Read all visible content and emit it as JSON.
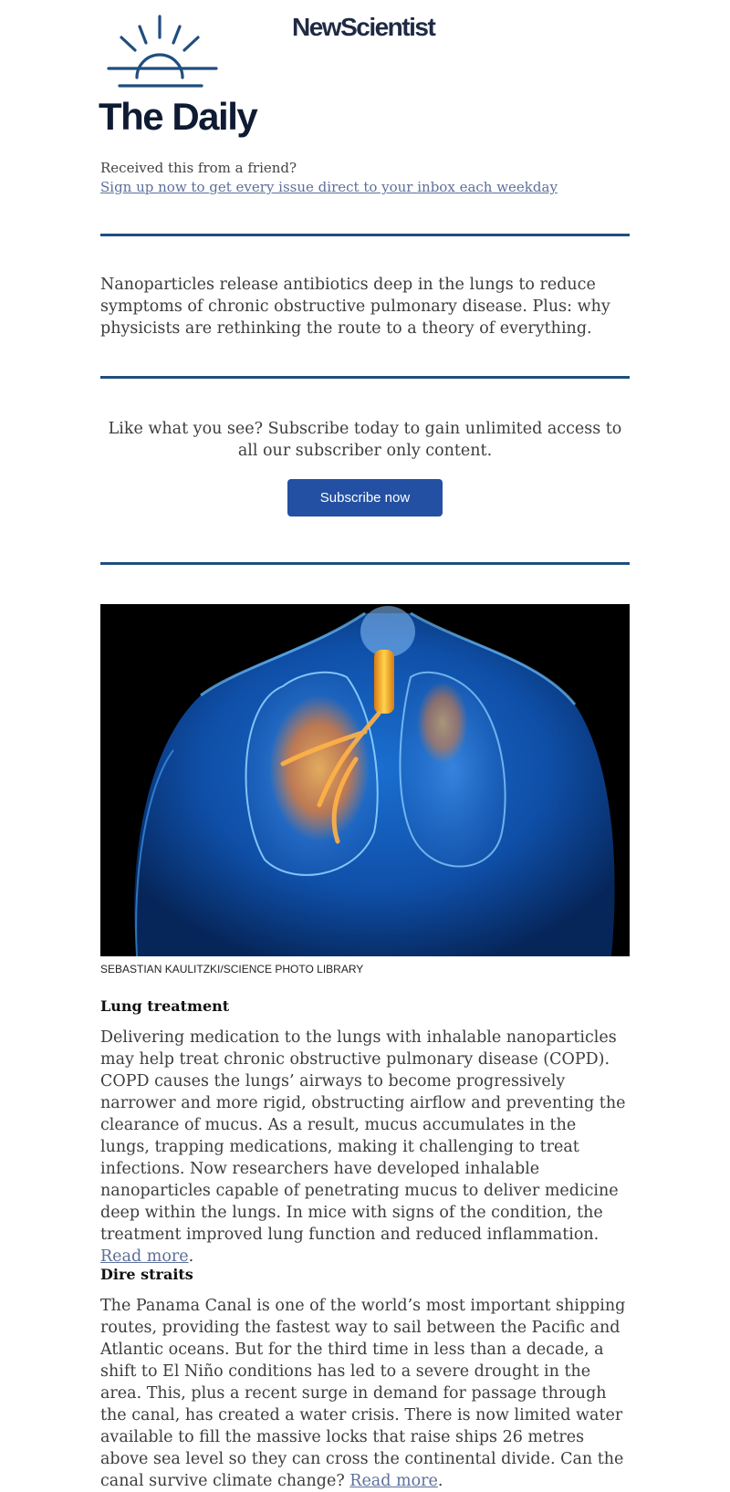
{
  "header": {
    "brand": "NewScientist",
    "newsletter_title": "The Daily",
    "received_text": "Received this from a friend?",
    "signup_link": "Sign up now to get every issue direct to your inbox each weekday"
  },
  "intro": "Nanoparticles release antibiotics deep in the lungs to reduce symptoms of chronic obstructive pulmonary disease. Plus: why physicists are rethinking the route to a theory of everything.",
  "promo": {
    "text": "Like what you see? Subscribe today to gain unlimited access to all our subscriber only content.",
    "button_label": "Subscribe now"
  },
  "image": {
    "credit": "SEBASTIAN KAULITZKI/SCIENCE PHOTO LIBRARY"
  },
  "stories": [
    {
      "heading": "Lung treatment",
      "body": "Delivering medication to the lungs with inhalable nanoparticles may help treat chronic obstructive pulmonary disease (COPD). COPD causes the lungs’ airways to become progressively narrower and more rigid, obstructing airflow and preventing the clearance of mucus. As a result, mucus accumulates in the lungs,  trapping medications, making it challenging to treat infections. Now researchers have developed inhalable nanoparticles capable of penetrating mucus to deliver medicine deep within the lungs. In mice with signs of the condition, the treatment improved lung function and reduced inflammation. ",
      "link": "Read more",
      "tail": "."
    },
    {
      "heading": "Dire straits",
      "body": "The Panama Canal is one of the world’s most important shipping routes, providing the fastest way to sail between the Pacific and Atlantic oceans. But for the third time in less than a decade, a shift to El Niño conditions has led to a severe drought in the area. This, plus a recent surge in demand for passage through the canal, has created a water crisis. There is now limited water available to fill the massive locks that raise ships 26 metres above sea level so they can cross the continental divide. Can the canal survive climate change? ",
      "link": "Read more",
      "tail": "."
    }
  ],
  "colors": {
    "rule": "#1f4e7e",
    "button": "#2350a2",
    "link": "#5d6f9a",
    "title": "#0f1b33"
  }
}
